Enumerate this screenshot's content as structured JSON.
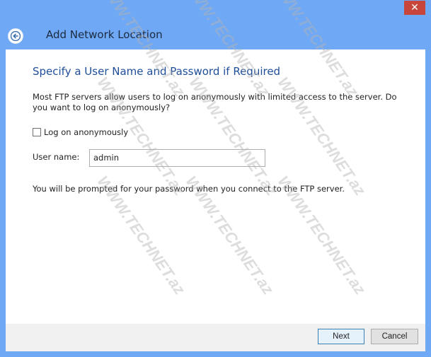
{
  "window": {
    "title": "Add Network Location",
    "close_glyph": "✕"
  },
  "main": {
    "heading": "Specify a User Name and Password if Required",
    "description": "Most FTP servers allow users to log on anonymously with limited access to the server.  Do you want to log on anonymously?",
    "anonymous_label": "Log on anonymously",
    "anonymous_checked": false,
    "username_label": "User name:",
    "username_value": "admin",
    "note": "You will be prompted for your password when you connect to the FTP server."
  },
  "footer": {
    "next_label": "Next",
    "cancel_label": "Cancel"
  },
  "watermark": "WWW.TECHNET.az",
  "colors": {
    "frame": "#6fa8f5",
    "close": "#c7453a",
    "heading": "#1f4e9a"
  }
}
